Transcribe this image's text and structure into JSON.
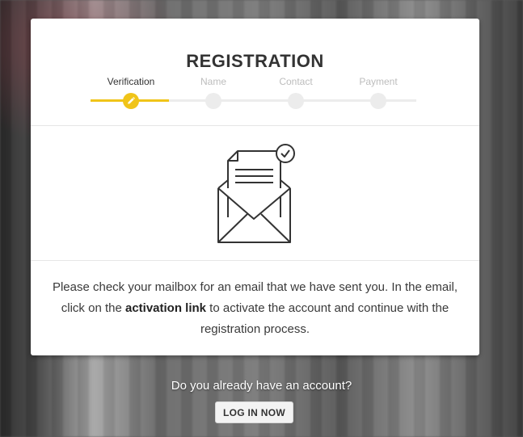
{
  "registration": {
    "title": "REGISTRATION",
    "steps": [
      {
        "label": "Verification",
        "state": "active"
      },
      {
        "label": "Name",
        "state": "inactive"
      },
      {
        "label": "Contact",
        "state": "inactive"
      },
      {
        "label": "Payment",
        "state": "inactive"
      }
    ],
    "message": {
      "before": "Please check your mailbox for an email that we have sent you. In the email, click on the ",
      "link_text": "activation link",
      "after": " to activate the account and continue with the registration process."
    }
  },
  "footer": {
    "question": "Do you already have an account?",
    "login_label": "LOG IN NOW"
  },
  "colors": {
    "accent": "#f0c419",
    "inactive": "#ececec",
    "text": "#333333"
  },
  "icons": {
    "step_active": "pencil-icon",
    "illustration": "envelope-letter-check-icon"
  }
}
